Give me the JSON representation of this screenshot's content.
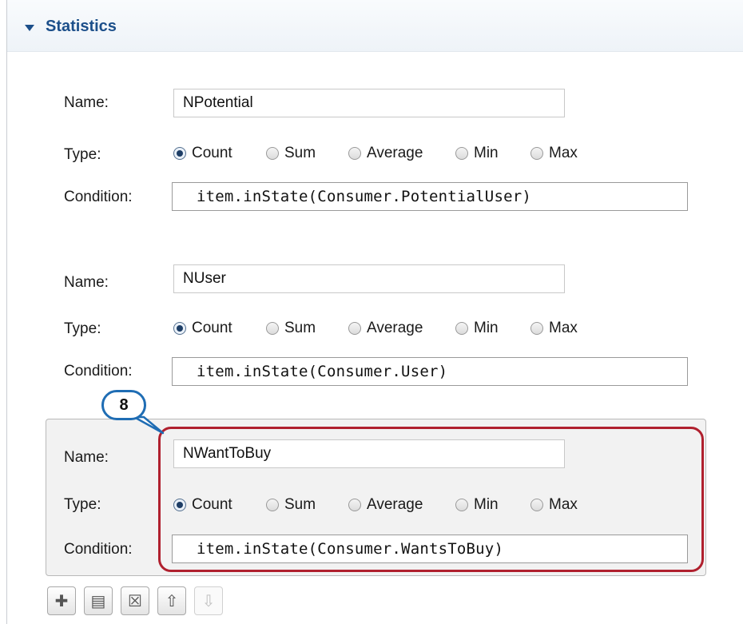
{
  "section": {
    "title": "Statistics"
  },
  "labels": {
    "name": "Name:",
    "type": "Type:",
    "condition": "Condition:"
  },
  "types": [
    "Count",
    "Sum",
    "Average",
    "Min",
    "Max"
  ],
  "stats": [
    {
      "name": "NPotential",
      "type": "Count",
      "condition": "item.inState(Consumer.PotentialUser)"
    },
    {
      "name": "NUser",
      "type": "Count",
      "condition": "item.inState(Consumer.User)"
    },
    {
      "name": "NWantToBuy",
      "type": "Count",
      "condition": "item.inState(Consumer.WantsToBuy)"
    }
  ],
  "callout": {
    "label": "8"
  },
  "toolbar": [
    {
      "name": "add-icon",
      "glyph": "✚",
      "enabled": true
    },
    {
      "name": "copy-icon",
      "glyph": "▤",
      "enabled": true
    },
    {
      "name": "delete-icon",
      "glyph": "☒",
      "enabled": true
    },
    {
      "name": "move-up-icon",
      "glyph": "⇧",
      "enabled": true
    },
    {
      "name": "move-down-icon",
      "glyph": "⇩",
      "enabled": false
    }
  ],
  "colors": {
    "accent": "#1c4f8a",
    "highlight": "#b0202e",
    "callout": "#1f6db4"
  }
}
